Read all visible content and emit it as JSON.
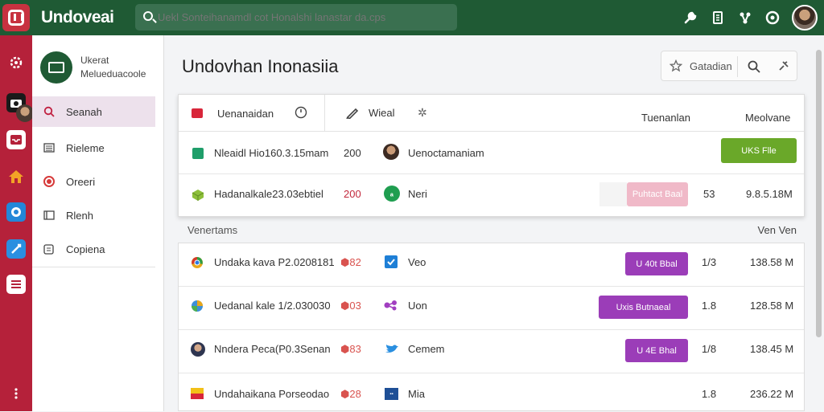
{
  "app": {
    "name": "Undoveai"
  },
  "search": {
    "placeholder": "Uekl Sonteihanamdl cot Honalshi lanastar da.cps"
  },
  "topbar": {
    "icons": [
      "wrench-icon",
      "document-icon",
      "share-icon",
      "help-icon",
      "user-avatar"
    ]
  },
  "rail": {
    "icons": [
      "settings-icon",
      "camera-icon",
      "inbox-icon",
      "home-icon",
      "chat-icon",
      "compose-icon",
      "list-icon",
      "more-icon"
    ]
  },
  "sidebar": {
    "project": {
      "line1": "Ukerat",
      "line2": "Melueduacoole"
    },
    "items": [
      {
        "label": "Seanah",
        "icon": "search-icon",
        "active": true
      },
      {
        "label": "Rieleme",
        "icon": "list-icon",
        "active": false
      },
      {
        "label": "Oreeri",
        "icon": "record-icon",
        "active": false
      },
      {
        "label": "Rlenh",
        "icon": "panel-icon",
        "active": false
      },
      {
        "label": "Copiena",
        "icon": "copy-icon",
        "active": false
      }
    ]
  },
  "page": {
    "title": "Undovhan Inonasiia"
  },
  "toolbar": {
    "label": "Gatadian"
  },
  "table1": {
    "tab1_label": "Uenanaidan",
    "tab2_label": "Wieal",
    "col_a": "Tuenanlan",
    "col_b": "Meolvane",
    "rows": [
      {
        "name": "Nleaidl Hio160.3.15mam",
        "num": "200",
        "owner": "Uenoctamaniam",
        "status": "UKS Flle",
        "status_color": "#6aa829",
        "qty": "",
        "size": ""
      },
      {
        "name": "Hadanalkale23.03ebtiel",
        "num": "200",
        "owner": "Neri",
        "status": "Puhtact Baal",
        "status_color": "#f0b9c8",
        "qty": "53",
        "size": "9.8.5.18M"
      }
    ]
  },
  "section": {
    "label": "Venertams",
    "right": "Ven Ven"
  },
  "table2": {
    "rows": [
      {
        "name": "Undaka kava P2.0208181",
        "num": "⬢82",
        "owner": "Veo",
        "status": "U 40t Bbal",
        "status_color": "#9b3db8",
        "qty": "1/3",
        "size": "138.58 M"
      },
      {
        "name": "Uedanal kale 1/2.030030",
        "num": "⬢03",
        "owner": "Uon",
        "status": "Uxis  Butnaeal",
        "status_color": "#9b3db8",
        "qty": "1.8",
        "size": "128.58 M"
      },
      {
        "name": "Nndera Peca(P0.3Senan",
        "num": "⬢83",
        "owner": "Cemem",
        "status": "U 4E Bhal",
        "status_color": "#9b3db8",
        "qty": "1/8",
        "size": "138.45 M"
      },
      {
        "name": "Undahaikana Porseodao",
        "num": "⬢28",
        "owner": "Mia",
        "status": "",
        "status_color": "",
        "qty": "1.8",
        "size": "236.22 M"
      }
    ]
  }
}
